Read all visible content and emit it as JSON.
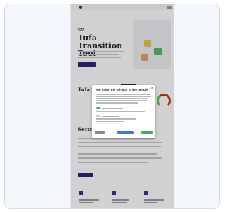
{
  "page": {
    "brand_color": "#3b1f7a",
    "overlay_color": "rgba(0,0,0,0.18)"
  },
  "topbar": {
    "icons": [
      "menu-icon",
      "brand-icon"
    ]
  },
  "hero": {
    "logo": "∞",
    "title": "Tufa Transition Tool"
  },
  "section2": {
    "title": "Tufa Tr..."
  },
  "section3": {
    "title": "Sector..."
  },
  "modal": {
    "title": "We value the privacy of the people",
    "close": "×",
    "buttons": {
      "accept_color": "#46a86a",
      "save_color": "#3b7bd6",
      "decline_color": "#8a8a8a"
    }
  }
}
